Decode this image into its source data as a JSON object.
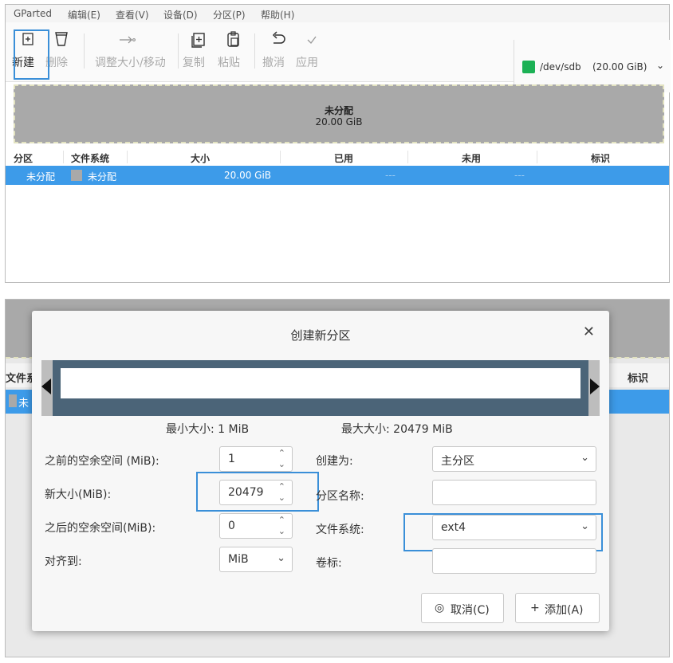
{
  "app": {
    "menu": [
      "GParted",
      "编辑(E)",
      "查看(V)",
      "设备(D)",
      "分区(P)",
      "帮助(H)"
    ],
    "toolbar": {
      "new": "新建",
      "delete": "删除",
      "resize_move": "调整大小/移动",
      "copy": "复制",
      "paste": "粘贴",
      "undo": "撤消",
      "apply": "应用"
    },
    "device": {
      "path": "/dev/sdb",
      "size": "(20.00 GiB)",
      "color": "#1cb155"
    },
    "partition_graph": {
      "label": "未分配",
      "size": "20.00 GiB"
    },
    "table": {
      "headers": [
        "分区",
        "文件系统",
        "大小",
        "已用",
        "未用",
        "标识"
      ],
      "rows": [
        {
          "partition": "未分配",
          "filesystem": "未分配",
          "size": "20.00 GiB",
          "used": "---",
          "unused": "---",
          "flags": ""
        }
      ],
      "selected_color": "#3d9be9"
    }
  },
  "dialog": {
    "title": "创建新分区",
    "min_size": "最小大小: 1 MiB",
    "max_size": "最大大小: 20479 MiB",
    "fields": {
      "free_before_label": "之前的空余空间 (MiB):",
      "free_before_value": "1",
      "new_size_label": "新大小(MiB):",
      "new_size_value": "20479",
      "free_after_label": "之后的空余空间(MiB):",
      "free_after_value": "0",
      "align_label": "对齐到:",
      "align_value": "MiB",
      "create_as_label": "创建为:",
      "create_as_value": "主分区",
      "name_label": "分区名称:",
      "name_value": "",
      "filesystem_label": "文件系统:",
      "filesystem_value": "ext4",
      "volume_label": "卷标:",
      "volume_value": ""
    },
    "buttons": {
      "cancel": "取消(C)",
      "add": "添加(A)"
    },
    "background_headers": {
      "filesystem_partial": "文件系",
      "flags": "标识",
      "row_partial": "未"
    },
    "highlight_color": "#3a8fd8"
  }
}
